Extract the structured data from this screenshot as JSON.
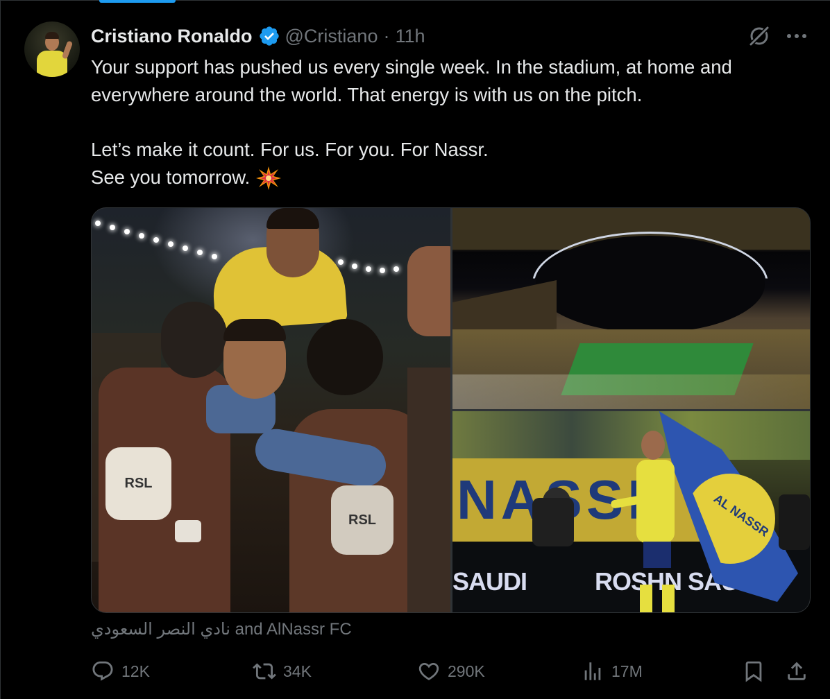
{
  "tweet": {
    "display_name": "Cristiano Ronaldo",
    "handle": "@Cristiano",
    "separator": "·",
    "timestamp": "11h",
    "text_lines": [
      "Your support has pushed us every single week. In the stadium, at home and",
      "everywhere around the world. That energy is with us on the pitch.",
      "Let’s make it count. For us. For you. For Nassr.",
      "See you tomorrow."
    ],
    "emoji": "collision-emoji",
    "mentions": "نادي النصر السعودي and AlNassr FC"
  },
  "media": {
    "photo_1_text": "RSL",
    "photo_3_banner": "NASSR",
    "photo_3_boards": [
      "SAUDI",
      "ROSHN SAUDI"
    ],
    "photo_3_flag_text": "AL NASSR"
  },
  "actions": {
    "replies": "12K",
    "reposts": "34K",
    "likes": "290K",
    "views": "17M"
  },
  "colors": {
    "background": "#000000",
    "text_primary": "#e7e9ea",
    "text_secondary": "#71767b",
    "verified": "#1d9bf0",
    "border": "#2f3336"
  },
  "icons": [
    "verified-badge-icon",
    "grok-icon",
    "more-icon",
    "reply-icon",
    "repost-icon",
    "like-icon",
    "views-icon",
    "bookmark-icon",
    "share-icon"
  ]
}
